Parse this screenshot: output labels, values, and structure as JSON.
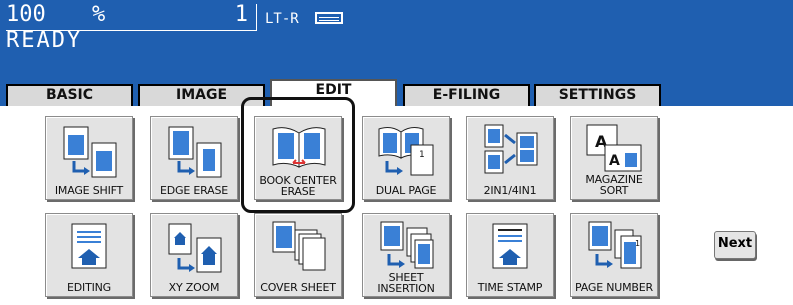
{
  "status": {
    "zoom_value": "100",
    "zoom_unit": "%",
    "copies": "1",
    "paper": "LT-R",
    "state": "READY"
  },
  "tabs": [
    {
      "label": "BASIC"
    },
    {
      "label": "IMAGE"
    },
    {
      "label": "EDIT"
    },
    {
      "label": "E-FILING"
    },
    {
      "label": "SETTINGS"
    }
  ],
  "functions_row1": [
    {
      "label": "IMAGE SHIFT",
      "icon": "image-shift-icon"
    },
    {
      "label": "EDGE ERASE",
      "icon": "edge-erase-icon"
    },
    {
      "label": "BOOK CENTER ERASE",
      "icon": "book-center-erase-icon"
    },
    {
      "label": "DUAL PAGE",
      "icon": "dual-page-icon"
    },
    {
      "label": "2IN1/4IN1",
      "icon": "2in1-4in1-icon"
    },
    {
      "label": "MAGAZINE SORT",
      "icon": "magazine-sort-icon"
    }
  ],
  "functions_row2": [
    {
      "label": "EDITING",
      "icon": "editing-icon"
    },
    {
      "label": "XY ZOOM",
      "icon": "xy-zoom-icon"
    },
    {
      "label": "COVER SHEET",
      "icon": "cover-sheet-icon"
    },
    {
      "label": "SHEET INSERTION",
      "icon": "sheet-insertion-icon"
    },
    {
      "label": "TIME STAMP",
      "icon": "time-stamp-icon"
    },
    {
      "label": "PAGE NUMBER",
      "icon": "page-number-icon"
    }
  ],
  "next_label": "Next",
  "colors": {
    "header": "#1f5fb0",
    "button": "#e3e3e3",
    "accent": "#3a80d6"
  }
}
